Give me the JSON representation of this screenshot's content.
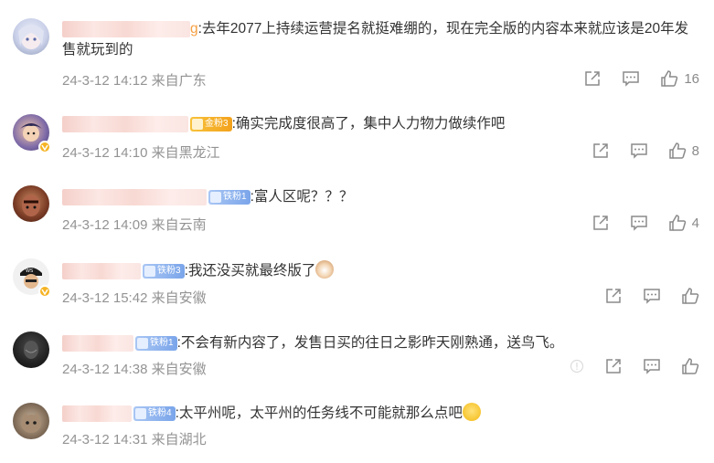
{
  "comments": [
    {
      "username_tail": "g",
      "text": ":去年2077上持续运营提名就挺难绷的，现在完全版的内容本来就应该是20年发售就玩到的",
      "time": "24-3-12 14:12",
      "location": "来自广东",
      "likes": "16"
    },
    {
      "badge": "金粉3",
      "text": ":确实完成度很高了，集中人力物力做续作吧",
      "time": "24-3-12 14:10",
      "location": "来自黑龙江",
      "likes": "8"
    },
    {
      "badge": "铁粉1",
      "text": ":富人区呢？？？",
      "time": "24-3-12 14:09",
      "location": "来自云南",
      "likes": "4"
    },
    {
      "badge": "铁粉3",
      "text": ":我还没买就最终版了",
      "time": "24-3-12 15:42",
      "location": "来自安徽",
      "likes": ""
    },
    {
      "badge": "铁粉1",
      "text": ":不会有新内容了，发售日买的往日之影昨天刚熟通，送鸟飞。",
      "time": "24-3-12 14:38",
      "location": "来自安徽",
      "likes": ""
    },
    {
      "badge": "铁粉4",
      "text": ":太平州呢，太平州的任务线不可能就那么点吧",
      "time": "24-3-12 14:31",
      "location": "来自湖北",
      "likes": ""
    }
  ],
  "colors": {
    "meta": "#939393",
    "icon": "#8a8a8a",
    "gold_badge": "#f3a21d",
    "iron_badge": "#7aa5ea",
    "verified": "#f5b324"
  },
  "icons": [
    "share-icon",
    "comment-icon",
    "like-icon",
    "cat-emoji",
    "crying-emoji",
    "info-icon",
    "verified-badge-icon"
  ]
}
